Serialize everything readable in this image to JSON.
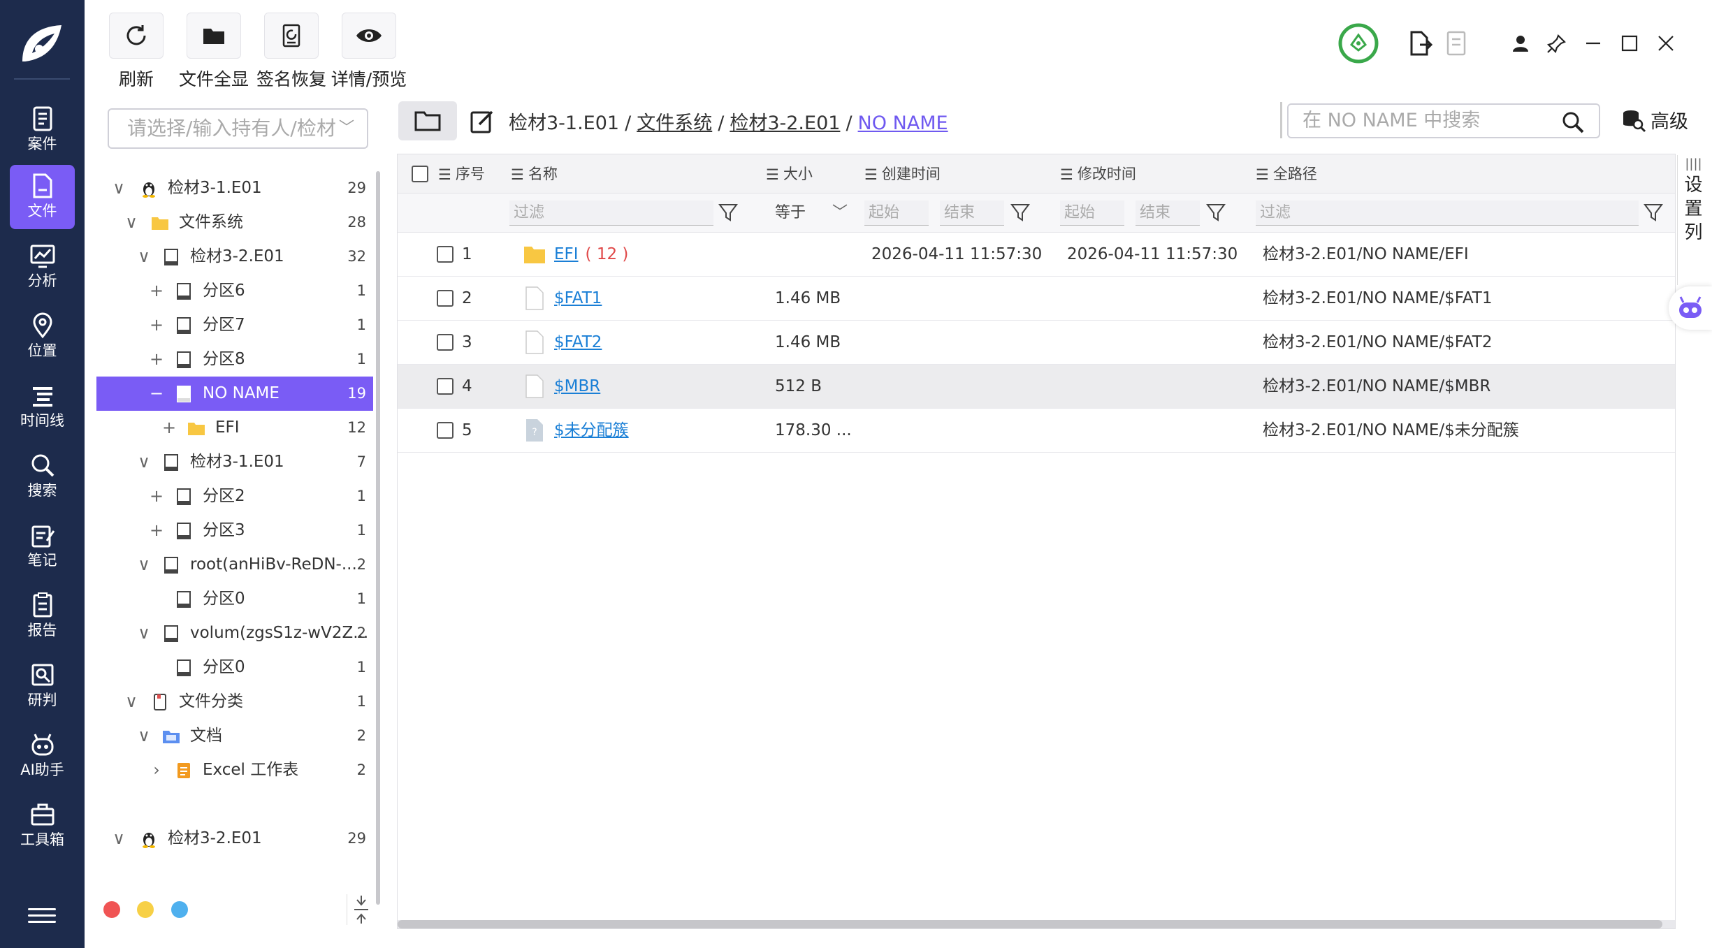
{
  "nav": {
    "items": [
      {
        "label": "案件",
        "icon": "case-icon"
      },
      {
        "label": "文件",
        "icon": "file-icon",
        "active": true
      },
      {
        "label": "分析",
        "icon": "analysis-icon"
      },
      {
        "label": "位置",
        "icon": "location-icon"
      },
      {
        "label": "时间线",
        "icon": "timeline-icon"
      },
      {
        "label": "搜索",
        "icon": "search-icon"
      },
      {
        "label": "笔记",
        "icon": "notes-icon"
      },
      {
        "label": "报告",
        "icon": "report-icon"
      },
      {
        "label": "研判",
        "icon": "judge-icon"
      },
      {
        "label": "AI助手",
        "icon": "ai-assistant-icon"
      },
      {
        "label": "工具箱",
        "icon": "toolbox-icon"
      }
    ]
  },
  "toolbar": {
    "refresh_label": "刷新",
    "show_all_label": "文件全显",
    "signature_recover_label": "签名恢复",
    "detail_preview_label": "详情/预览"
  },
  "owner_select": {
    "placeholder": "请选择/输入持有人/检材"
  },
  "tree": [
    {
      "label": "检材3-1.E01",
      "count": "29"
    },
    {
      "label": "文件系统",
      "count": "28"
    },
    {
      "label": "检材3-2.E01",
      "count": "32"
    },
    {
      "label": "分区6",
      "count": "1"
    },
    {
      "label": "分区7",
      "count": "1"
    },
    {
      "label": "分区8",
      "count": "1"
    },
    {
      "label": "NO NAME",
      "count": "19"
    },
    {
      "label": "EFI",
      "count": "12"
    },
    {
      "label": "检材3-1.E01",
      "count": "7"
    },
    {
      "label": "分区2",
      "count": "1"
    },
    {
      "label": "分区3",
      "count": "1"
    },
    {
      "label": "root(anHiBv-ReDN-...",
      "count": "2"
    },
    {
      "label": "分区0",
      "count": "1"
    },
    {
      "label": "volum(zgsS1z-wV2Z...",
      "count": "2"
    },
    {
      "label": "分区0",
      "count": "1"
    },
    {
      "label": "文件分类",
      "count": "1"
    },
    {
      "label": "文档",
      "count": "2"
    },
    {
      "label": "Excel 工作表",
      "count": "2"
    },
    {
      "label": "检材3-2.E01",
      "count": "29"
    }
  ],
  "breadcrumb": {
    "parts": [
      "检材3-1.E01",
      "文件系统",
      "检材3-2.E01"
    ],
    "sep": "/",
    "current": "NO NAME"
  },
  "search": {
    "placeholder": "在 NO NAME 中搜索"
  },
  "advanced_label": "高级",
  "table": {
    "headers": {
      "index": "序号",
      "name": "名称",
      "size": "大小",
      "created": "创建时间",
      "modified": "修改时间",
      "path": "全路径"
    },
    "filter": {
      "filter": "过滤",
      "equals": "等于",
      "start": "起始",
      "end": "结束"
    },
    "rows": [
      {
        "index": "1",
        "name": "EFI",
        "count": "( 12 )",
        "size": "",
        "created": "2026-04-11 11:57:30",
        "modified": "2026-04-11 11:57:30",
        "path": "检材3-2.E01/NO NAME/EFI",
        "type": "folder"
      },
      {
        "index": "2",
        "name": "$FAT1",
        "count": "",
        "size": "1.46 MB",
        "created": "",
        "modified": "",
        "path": "检材3-2.E01/NO NAME/$FAT1",
        "type": "file"
      },
      {
        "index": "3",
        "name": "$FAT2",
        "count": "",
        "size": "1.46 MB",
        "created": "",
        "modified": "",
        "path": "检材3-2.E01/NO NAME/$FAT2",
        "type": "file"
      },
      {
        "index": "4",
        "name": "$MBR",
        "count": "",
        "size": "512 B",
        "created": "",
        "modified": "",
        "path": "检材3-2.E01/NO NAME/$MBR",
        "type": "file"
      },
      {
        "index": "5",
        "name": "$未分配簇",
        "count": "",
        "size": "178.30 ...",
        "created": "",
        "modified": "",
        "path": "检材3-2.E01/NO NAME/$未分配簇",
        "type": "unknown"
      }
    ]
  },
  "settings_column_label": "设置列",
  "colors": {
    "nav_bg": "#1d2b4c",
    "accent": "#7a5cf5",
    "link": "#1a7fd6",
    "dot_red": "#f05454",
    "dot_yellow": "#f7d046",
    "dot_blue": "#4fb0ee",
    "status_green": "#3aa84a"
  }
}
